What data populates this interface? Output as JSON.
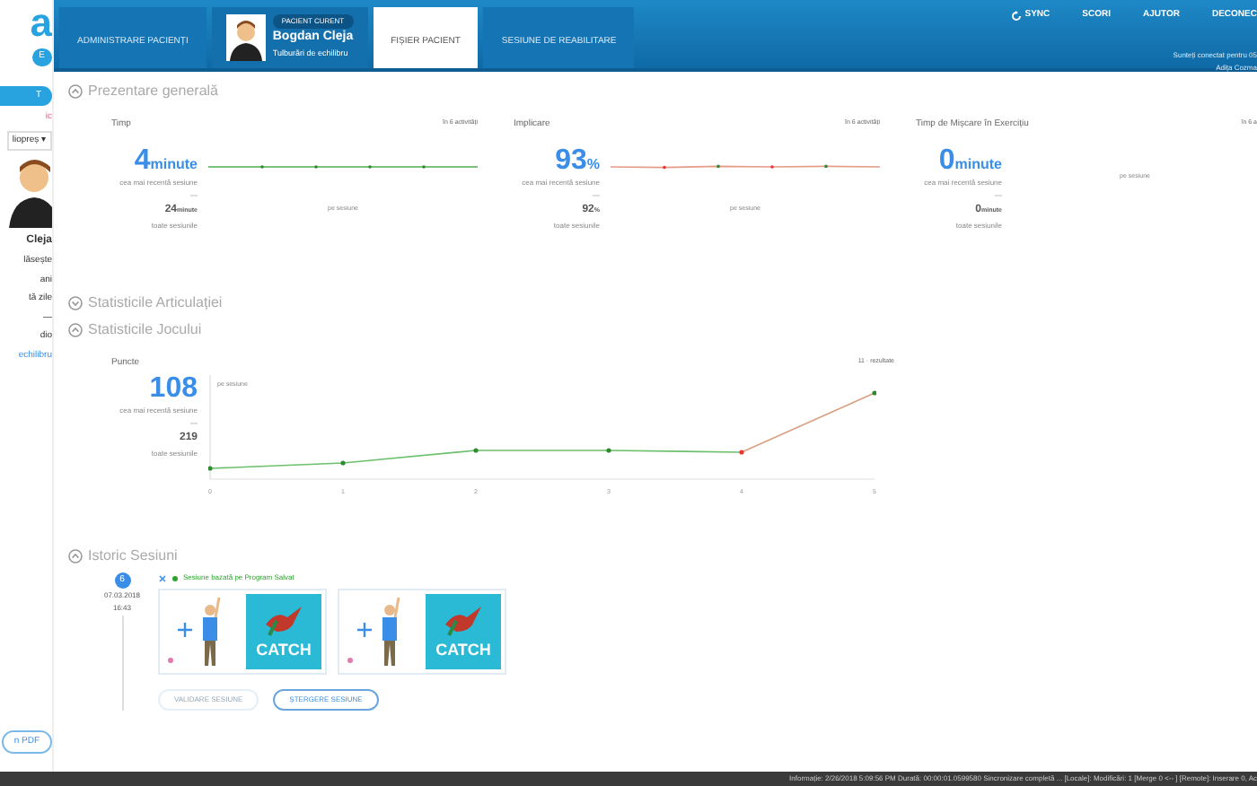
{
  "sidebar": {
    "logo": "a",
    "badge": "E",
    "button": "T",
    "items": [
      {
        "text": "ic",
        "kind": "pink"
      },
      {
        "text": "liopreș ▾",
        "kind": "select"
      },
      {
        "text": "Cleja",
        "kind": "name"
      },
      {
        "text": "lăsește",
        "kind": "plain"
      },
      {
        "text": "ani",
        "kind": "plain"
      },
      {
        "text": "tă zile",
        "kind": "plain"
      },
      {
        "text": "—",
        "kind": "plain"
      },
      {
        "text": "dio",
        "kind": "plain"
      },
      {
        "text": "echilibru",
        "kind": "link"
      }
    ],
    "pdf_button": "n PDF"
  },
  "header": {
    "admin_tab": "ADMINISTRARE PACIENȚI",
    "patient": {
      "caption": "PACIENT CURENT",
      "name": "Bogdan Cleja",
      "diagnosis": "Tulburări de echilibru"
    },
    "tabs": [
      {
        "label": "FIȘIER PACIENT",
        "selected": true
      },
      {
        "label": "SESIUNE DE REABILITARE",
        "selected": false
      }
    ],
    "nav": [
      {
        "label": "SYNC",
        "kind": "sync"
      },
      {
        "label": "SCORI",
        "kind": "plain"
      },
      {
        "label": "AJUTOR",
        "kind": "plain"
      },
      {
        "label": "DECONEC",
        "kind": "plain"
      }
    ],
    "notice": [
      "Sunteți conectat pentru 05",
      "Adița Cozma"
    ]
  },
  "overview": {
    "title": "Prezentare generală",
    "expanded": true,
    "cards": [
      {
        "title": "Timp",
        "count": "în 6 activități",
        "value": "4",
        "unit": "minute",
        "recent": "cea mai recentă sesiune",
        "dash": "—",
        "total": "24",
        "total_unit": "minute",
        "total_label": "toate sesiunile",
        "per": "pe sesiune",
        "kind": "green"
      },
      {
        "title": "Implicare",
        "count": "în 6 activități",
        "value": "93",
        "unit": "%",
        "recent": "cea mai recentă sesiune",
        "dash": "—",
        "total": "92",
        "total_unit": "%",
        "total_label": "toate sesiunile",
        "per": "pe sesiune",
        "kind": "mixed"
      },
      {
        "title": "Timp de Mișcare în Exercițiu",
        "count": "în 6 a",
        "value": "0",
        "unit": "minute",
        "recent": "cea mai recentă sesiune",
        "dash": "—",
        "total": "0",
        "total_unit": "minute",
        "total_label": "toate sesiunile",
        "per": "pe sesiune",
        "kind": "none"
      }
    ]
  },
  "joint_stats": {
    "title": "Statisticile Articulației",
    "expanded": false
  },
  "game_stats": {
    "title": "Statisticile Jocului",
    "expanded": true,
    "metric": "Puncte",
    "count": "11 · rezultate",
    "value": "108",
    "recent": "cea mai recentă sesiune",
    "dash": "—",
    "total": "219",
    "total_label": "toate sesiunile",
    "per": "pe sesiune",
    "xticks": [
      "0",
      "1",
      "2",
      "3",
      "4",
      "5"
    ]
  },
  "history": {
    "title": "Istoric Sesiuni",
    "expanded": true,
    "sessions": [
      {
        "number": "6",
        "date": "07.03.2018",
        "time": "16:43",
        "tag": "Sesiune bazată pe Program Salvat",
        "exercises": [
          {
            "game": "CATCH"
          },
          {
            "game": "CATCH"
          }
        ],
        "buttons": [
          {
            "label": "VALIDARE SESIUNE",
            "disabled": true
          },
          {
            "label": "ȘTERGERE SESIUNE",
            "disabled": false
          }
        ]
      }
    ]
  },
  "status_bar": "Informație: 2/26/2018 5:09:56 PM Durată: 00:00:01.0599580 Sincronizare completă ... [Locale]: Modificări: 1 [Merge 0 <-- ] [Remote]: Inserare 0, Ac"
}
